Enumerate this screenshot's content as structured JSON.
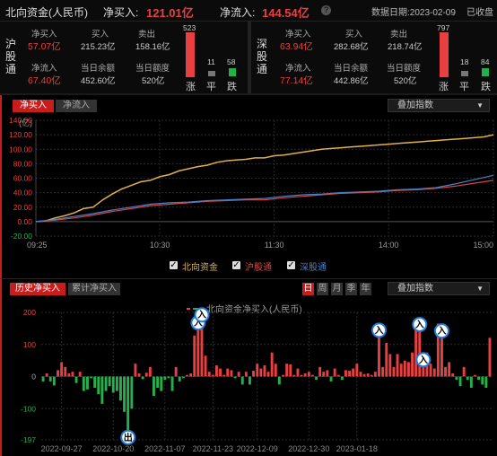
{
  "header": {
    "title": "北向资金(人民币)",
    "net_buy_label": "净买入:",
    "net_buy_value": "121.01亿",
    "net_inflow_label": "净流入:",
    "net_inflow_value": "144.54亿",
    "help_icon": "?",
    "date_label": "数据日期:2023-02-09",
    "status": "已收盘"
  },
  "hu": {
    "side_label": "沪股通",
    "net_buy_label": "净买入",
    "net_buy_value": "57.07亿",
    "buy_label": "买入",
    "buy_value": "215.23亿",
    "sell_label": "卖出",
    "sell_value": "158.16亿",
    "net_inflow_label": "净流入",
    "net_inflow_value": "67.40亿",
    "balance_label": "当日余额",
    "balance_value": "452.60亿",
    "quota_label": "当日额度",
    "quota_value": "520亿",
    "up_count": "523",
    "flat_count": "11",
    "down_count": "58",
    "up_label": "涨",
    "flat_label": "平",
    "down_label": "跌"
  },
  "shen": {
    "side_label": "深股通",
    "net_buy_label": "净买入",
    "net_buy_value": "63.94亿",
    "buy_label": "买入",
    "buy_value": "282.68亿",
    "sell_label": "卖出",
    "sell_value": "218.74亿",
    "net_inflow_label": "净流入",
    "net_inflow_value": "77.14亿",
    "balance_label": "当日余额",
    "balance_value": "442.86亿",
    "quota_label": "当日额度",
    "quota_value": "520亿",
    "up_count": "797",
    "flat_count": "18",
    "down_count": "84",
    "up_label": "涨",
    "flat_label": "平",
    "down_label": "跌"
  },
  "intraday_tabs": {
    "active": "净买入",
    "inactive": "净流入",
    "overlay": "叠加指数"
  },
  "history_tabs": {
    "active": "历史净买入",
    "inactive": "累计净买入",
    "periods": [
      "日",
      "周",
      "月",
      "季",
      "年"
    ],
    "overlay": "叠加指数"
  },
  "colors": {
    "north": "#e0b04a",
    "hu": "#d94545",
    "shen": "#4b7fc8",
    "up": "#e84040",
    "down": "#22b14c"
  },
  "chart_data": [
    {
      "type": "line",
      "ylabel": "(亿)",
      "ylim": [
        -20,
        140
      ],
      "yticks": [
        "140.00",
        "120.00",
        "100.00",
        "80.00",
        "60.00",
        "40.00",
        "20.00",
        "0.00",
        "-20.00"
      ],
      "yvals": [
        140,
        120,
        100,
        80,
        60,
        40,
        20,
        0,
        -20
      ],
      "xticks": [
        "09:25",
        "10:30",
        "11:30",
        "14:00",
        "15:00"
      ],
      "xtick_pos": [
        0,
        65,
        125,
        185,
        240
      ],
      "xlim": [
        0,
        240
      ],
      "legend": [
        "北向资金",
        "沪股通",
        "深股通"
      ],
      "series": [
        {
          "name": "北向资金",
          "x": [
            0,
            5,
            10,
            15,
            20,
            25,
            30,
            35,
            40,
            45,
            50,
            55,
            60,
            65,
            70,
            75,
            80,
            85,
            90,
            95,
            100,
            105,
            110,
            115,
            120,
            125,
            130,
            135,
            140,
            145,
            150,
            155,
            160,
            165,
            170,
            175,
            180,
            185,
            190,
            195,
            200,
            205,
            210,
            215,
            220,
            225,
            230,
            235,
            240
          ],
          "y": [
            0,
            1,
            5,
            8,
            12,
            18,
            20,
            30,
            38,
            45,
            50,
            55,
            57,
            62,
            65,
            70,
            73,
            76,
            78,
            82,
            84,
            85,
            86,
            88,
            88,
            91,
            92,
            94,
            96,
            98,
            100,
            101,
            102,
            103,
            104,
            105,
            106,
            107,
            108,
            109,
            110,
            111,
            112,
            113,
            114,
            115,
            116,
            117,
            120
          ]
        },
        {
          "name": "沪股通",
          "x": [
            0,
            10,
            20,
            30,
            40,
            50,
            60,
            70,
            80,
            90,
            100,
            110,
            120,
            130,
            140,
            150,
            160,
            170,
            180,
            190,
            200,
            210,
            220,
            230,
            240
          ],
          "y": [
            0,
            2,
            5,
            9,
            14,
            18,
            22,
            24,
            26,
            28,
            29,
            30,
            30,
            33,
            35,
            37,
            39,
            40,
            41,
            43,
            44,
            46,
            49,
            53,
            57
          ]
        },
        {
          "name": "深股通",
          "x": [
            0,
            10,
            20,
            30,
            40,
            50,
            60,
            70,
            80,
            90,
            100,
            110,
            120,
            130,
            140,
            150,
            160,
            170,
            180,
            190,
            200,
            210,
            220,
            230,
            240
          ],
          "y": [
            0,
            3,
            7,
            11,
            16,
            20,
            24,
            26,
            27,
            29,
            30,
            31,
            32,
            35,
            37,
            38,
            40,
            41,
            42,
            44,
            45,
            47,
            52,
            58,
            64
          ]
        }
      ]
    },
    {
      "type": "bar",
      "legend": "北向资金净买入(人民币)",
      "ylim": [
        -197,
        200
      ],
      "yticks": [
        "200",
        "100",
        "0",
        "-100",
        "-197"
      ],
      "yvals": [
        200,
        100,
        0,
        -100,
        -197
      ],
      "xticks": [
        "2022-09-27",
        "2022-10-20",
        "2022-11-07",
        "2022-11-23",
        "2022-12-09",
        "2022-12-30",
        "2023-01-18"
      ],
      "xtick_idx": [
        5,
        19,
        33,
        46,
        58,
        72,
        85
      ],
      "values": [
        -15,
        10,
        -15,
        -28,
        20,
        45,
        30,
        10,
        15,
        -20,
        15,
        -45,
        -40,
        -5,
        -35,
        -55,
        -85,
        -45,
        -30,
        -50,
        -45,
        -75,
        -110,
        -167,
        -100,
        40,
        10,
        -8,
        12,
        30,
        -60,
        -35,
        -45,
        -10,
        -5,
        -45,
        30,
        -15,
        -5,
        5,
        10,
        128,
        145,
        170,
        65,
        15,
        5,
        35,
        25,
        5,
        25,
        20,
        -5,
        15,
        -25,
        15,
        -25,
        18,
        40,
        25,
        35,
        15,
        75,
        40,
        -25,
        5,
        40,
        38,
        5,
        25,
        5,
        10,
        15,
        5,
        -10,
        30,
        15,
        20,
        -15,
        25,
        5,
        -10,
        20,
        18,
        25,
        40,
        15,
        8,
        10,
        5,
        15,
        122,
        30,
        105,
        70,
        30,
        70,
        40,
        50,
        45,
        75,
        155,
        140,
        30,
        75,
        40,
        25,
        165,
        120,
        30,
        45,
        10,
        -10,
        -30,
        30,
        -10,
        -35,
        5,
        -10,
        -25,
        -35,
        121
      ],
      "markers": [
        {
          "index": 23,
          "label": "出"
        },
        {
          "index": 42,
          "label": "入"
        },
        {
          "index": 43,
          "label": "入"
        },
        {
          "index": 91,
          "label": "入"
        },
        {
          "index": 102,
          "label": "入"
        },
        {
          "index": 103,
          "label": "入"
        },
        {
          "index": 108,
          "label": "入"
        }
      ]
    }
  ]
}
